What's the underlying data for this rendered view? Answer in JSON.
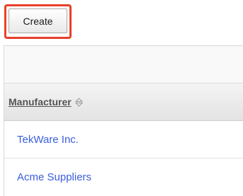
{
  "toolbar": {
    "create_label": "Create"
  },
  "table": {
    "column_header": "Manufacturer",
    "sort_icon": "sort-arrows-icon",
    "rows": [
      {
        "name": "TekWare Inc."
      },
      {
        "name": "Acme Suppliers"
      }
    ]
  },
  "colors": {
    "highlight_border": "#e8402a",
    "link": "#3a5edc",
    "header_text": "#555555"
  }
}
